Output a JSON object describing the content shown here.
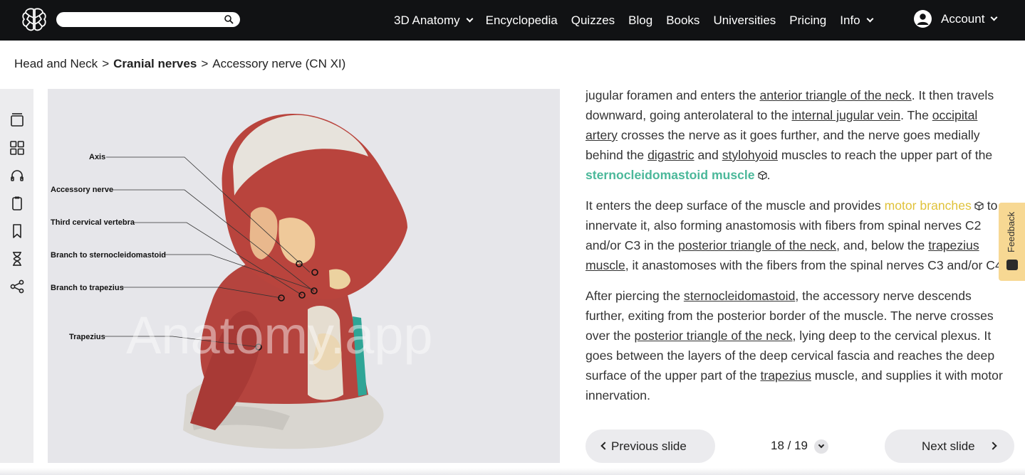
{
  "nav": {
    "items": [
      "3D Anatomy",
      "Encyclopedia",
      "Quizzes",
      "Blog",
      "Books",
      "Universities",
      "Pricing",
      "Info"
    ],
    "account": "Account"
  },
  "breadcrumb": {
    "part1": "Head and Neck",
    "part2": "Cranial nerves",
    "part3": "Accessory nerve (CN XI)"
  },
  "figure": {
    "labels": [
      "Axis",
      "Accessory nerve",
      "Third cervical vertebra",
      "Branch to sternocleidomastoid",
      "Branch to trapezius",
      "Trapezius"
    ],
    "watermark": "Anatomy.app"
  },
  "article": {
    "p1": {
      "t1": "jugular foramen and enters the ",
      "l1": "anterior triangle of the neck",
      "t2": ". It then travels downward, going anterolateral to the ",
      "l2": "internal jugular vein",
      "t3": ". The ",
      "l3": "occipital artery",
      "t4": " crosses the nerve as it goes further, and the nerve goes medially behind the ",
      "l4": "digastric",
      "t5": " and ",
      "l5": "stylohyoid",
      "t6": " muscles to reach the upper part of the ",
      "l6": "sternocleidomastoid muscle",
      "t7": "."
    },
    "p2": {
      "t1": "It enters the deep surface of the muscle and provides ",
      "l1": "motor branches",
      "t2": " to innervate it, also forming anastomosis with fibers from spinal nerves C2 and/or C3 in the ",
      "l2": "posterior triangle of the neck",
      "t3": ", and, below the ",
      "l3": "trapezius muscle",
      "t4": ", it anastomoses with the fibers from the spinal nerves C3 and/or C4."
    },
    "p3": {
      "t1": "After piercing the ",
      "l1": "sternocleidomastoid",
      "t2": ", the accessory nerve descends further, exiting from the posterior border of the muscle. The nerve crosses over the ",
      "l2": "posterior triangle of the neck",
      "t3": ", lying deep to the cervical plexus. It goes between the layers of the deep cervical fascia and reaches the deep surface of the upper part of the ",
      "l3": "trapezius",
      "t4": " muscle, and supplies it with motor innervation."
    }
  },
  "pager": {
    "prev": "Previous slide",
    "next": "Next slide",
    "count": "18 / 19"
  },
  "feedback": "Feedback",
  "colors": {
    "nav_bg": "#111214",
    "green_link": "#4bb89a",
    "yellow_link": "#e0c23a",
    "feedback_bg": "#f7d893"
  },
  "icons": [
    "brain-logo-icon",
    "search-icon",
    "chevron-down-icon",
    "account-icon",
    "layers-icon",
    "grid-icon",
    "headphones-icon",
    "clipboard-icon",
    "bookmark-icon",
    "hourglass-icon",
    "share-icon",
    "cube-icon",
    "chevron-left-icon",
    "chevron-right-icon"
  ]
}
